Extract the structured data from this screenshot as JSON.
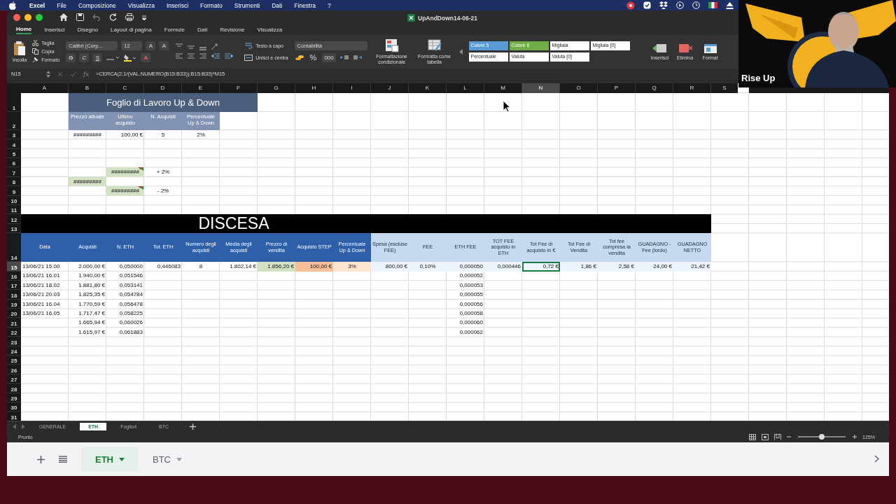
{
  "menubar": {
    "app_name": "Excel",
    "items": [
      "File",
      "Composizione",
      "Visualizza",
      "Inserisci",
      "Formato",
      "Strumenti",
      "Dati",
      "Finestra",
      "?"
    ]
  },
  "window": {
    "title": "UpAndDown14-06-21"
  },
  "ribbon_tabs": [
    {
      "label": "Home",
      "selected": true
    },
    {
      "label": "Inserisci",
      "selected": false
    },
    {
      "label": "Disegno",
      "selected": false
    },
    {
      "label": "Layout di pagina",
      "selected": false
    },
    {
      "label": "Formule",
      "selected": false
    },
    {
      "label": "Dati",
      "selected": false
    },
    {
      "label": "Revisione",
      "selected": false
    },
    {
      "label": "Visualizza",
      "selected": false
    }
  ],
  "ribbon": {
    "paste": "Incolla",
    "cut": "Taglia",
    "copy": "Copia",
    "format_painter": "Formato",
    "font_name": "Calibri (Corp...",
    "font_size": "12",
    "grow": "A",
    "shrink": "A",
    "bold": "G",
    "italic": "C",
    "underline": "S",
    "font_color": "A",
    "wrap": "Testo a capo",
    "merge": "Unisci e centra",
    "number_format": "Contabilità",
    "percent": "%",
    "thousands": "000",
    "conditional": "Formattazione condizionale",
    "as_table": "Formatta come tabella",
    "styles": [
      {
        "label": "Colore 5",
        "kind": "accent",
        "color": "#5b9bd5"
      },
      {
        "label": "Colore 6",
        "kind": "accent",
        "color": "#70ad47"
      },
      {
        "label": "Migliaia",
        "kind": "plain"
      },
      {
        "label": "Migliaia [0]",
        "kind": "plain"
      },
      {
        "label": "Percentuale",
        "kind": "plain"
      },
      {
        "label": "Valuta",
        "kind": "plain"
      },
      {
        "label": "Valuta [0]",
        "kind": "plain"
      }
    ],
    "cells": [
      "Inserisci",
      "Elimina",
      "Format"
    ]
  },
  "formula_bar": {
    "name_box": "N15",
    "fx": "fx",
    "formula": "=CERCA(2;1/(VAL.NUMERO(B15:B33));B15:B33)*M15"
  },
  "sheet": {
    "columns": [
      {
        "letter": "A",
        "selected": false
      },
      {
        "letter": "B",
        "selected": false
      },
      {
        "letter": "C",
        "selected": false
      },
      {
        "letter": "D",
        "selected": false
      },
      {
        "letter": "E",
        "selected": false
      },
      {
        "letter": "F",
        "selected": false
      },
      {
        "letter": "G",
        "selected": false
      },
      {
        "letter": "H",
        "selected": false
      },
      {
        "letter": "I",
        "selected": false
      },
      {
        "letter": "J",
        "selected": false
      },
      {
        "letter": "K",
        "selected": false
      },
      {
        "letter": "L",
        "selected": false
      },
      {
        "letter": "M",
        "selected": false
      },
      {
        "letter": "N",
        "selected": true
      },
      {
        "letter": "O",
        "selected": false
      },
      {
        "letter": "P",
        "selected": false
      },
      {
        "letter": "Q",
        "selected": false
      },
      {
        "letter": "R",
        "selected": false
      },
      {
        "letter": "S",
        "selected": false
      }
    ],
    "rows": [
      {
        "label": "1",
        "selected": false
      },
      {
        "label": "2",
        "selected": false
      },
      {
        "label": "3",
        "selected": false
      },
      {
        "label": "4",
        "selected": false
      },
      {
        "label": "5",
        "selected": false
      },
      {
        "label": "6",
        "selected": false
      },
      {
        "label": "7",
        "selected": false
      },
      {
        "label": "8",
        "selected": false
      },
      {
        "label": "9",
        "selected": false
      },
      {
        "label": "10",
        "selected": false
      },
      {
        "label": "11",
        "selected": false
      },
      {
        "label": "12",
        "selected": false
      },
      {
        "label": "13",
        "selected": false
      },
      {
        "label": "14",
        "selected": false
      },
      {
        "label": "15",
        "selected": true
      },
      {
        "label": "16",
        "selected": false
      },
      {
        "label": "17",
        "selected": false
      },
      {
        "label": "18",
        "selected": false
      },
      {
        "label": "19",
        "selected": false
      },
      {
        "label": "20",
        "selected": false
      },
      {
        "label": "21",
        "selected": false
      },
      {
        "label": "22",
        "selected": false
      },
      {
        "label": "23",
        "selected": false
      },
      {
        "label": "24",
        "selected": false
      },
      {
        "label": "25",
        "selected": false
      },
      {
        "label": "26",
        "selected": false
      },
      {
        "label": "27",
        "selected": false
      },
      {
        "label": "28",
        "selected": false
      },
      {
        "label": "29",
        "selected": false
      },
      {
        "label": "30",
        "selected": false
      },
      {
        "label": "31",
        "selected": false
      }
    ],
    "summary": {
      "title": "Foglio di Lavoro Up & Down",
      "headers": [
        "Prezzo attuale",
        "Ultimo acquisto",
        "N. Acquisti",
        "Percentuale Up & Down"
      ],
      "values": [
        "#########",
        "100,00 €",
        "5",
        "2%"
      ]
    },
    "levels": {
      "upper": {
        "value": "#########",
        "label": "+ 2%",
        "comment": true
      },
      "current": "#########",
      "lower": {
        "value": "#########",
        "label": "- 2%",
        "comment": true
      }
    },
    "section": "DISCESA",
    "table": {
      "columns": [
        {
          "label": "Data",
          "kind": "dark"
        },
        {
          "label": "Acquisti",
          "kind": "dark"
        },
        {
          "label": "N. ETH",
          "kind": "dark"
        },
        {
          "label": "Tot. ETH",
          "kind": "dark"
        },
        {
          "label": "Numero degli acquisti",
          "kind": "dark"
        },
        {
          "label": "Media degli acquisti",
          "kind": "dark"
        },
        {
          "label": "Prezzo di vendita",
          "kind": "dark"
        },
        {
          "label": "Acquisto STEP",
          "kind": "dark"
        },
        {
          "label": "Percentuale Up & Down",
          "kind": "dark"
        },
        {
          "label": "Spesa (escluse FEE)",
          "kind": "light"
        },
        {
          "label": "FEE",
          "kind": "light"
        },
        {
          "label": "ETH FEE",
          "kind": "light"
        },
        {
          "label": "TOT FEE acquisto in ETH",
          "kind": "light"
        },
        {
          "label": "Tot Fee di acquisto in €",
          "kind": "light"
        },
        {
          "label": "Tot Fee di Vendita",
          "kind": "light"
        },
        {
          "label": "Tot fee compresa la vendita",
          "kind": "light"
        },
        {
          "label": "GUADAGNO - Fee (lordo)",
          "kind": "light"
        },
        {
          "label": "GUADAGNO NETTO",
          "kind": "light"
        }
      ],
      "rows": [
        {
          "data": "13/06/21 15.00",
          "acquisti": "2.000,00 €",
          "n_eth": "0,050000",
          "tot_eth": "0,446083",
          "numero": "8",
          "media": "1.802,14 €",
          "prezzo_vendita": "1.856,20 €",
          "step": "100,00 €",
          "percentuale": "3%",
          "spesa": "800,00 €",
          "fee": "0,10%",
          "eth_fee": "0,000050",
          "fee_eth": "0,000446",
          "fee_eur": "0,72 €",
          "fee_vendita": "1,86 €",
          "fee_totale": "2,58 €",
          "lordo": "24,00 €",
          "netto": "21,42 €"
        },
        {
          "data": "13/06/21 16.01",
          "acquisti": "1.940,00 €",
          "n_eth": "0,051546",
          "eth_fee": "0,000052"
        },
        {
          "data": "13/06/21 18.02",
          "acquisti": "1.881,80 €",
          "n_eth": "0,053141",
          "eth_fee": "0,000053"
        },
        {
          "data": "13/06/21 20.03",
          "acquisti": "1.825,35 €",
          "n_eth": "0,054784",
          "eth_fee": "0,000055"
        },
        {
          "data": "13/06/21 16.04",
          "acquisti": "1.770,59 €",
          "n_eth": "0,056478",
          "eth_fee": "0,000056"
        },
        {
          "data": "13/06/21 16.05",
          "acquisti": "1.717,47 €",
          "n_eth": "0,058225",
          "eth_fee": "0,000058"
        },
        {
          "acquisti": "1.665,94 €",
          "n_eth": "0,060026",
          "eth_fee": "0,000060"
        },
        {
          "acquisti": "1.615,97 €",
          "n_eth": "0,061883",
          "eth_fee": "0,000062"
        }
      ]
    }
  },
  "sheet_tabs": [
    {
      "label": "GENERALE",
      "selected": false
    },
    {
      "label": "ETH",
      "selected": true
    },
    {
      "label": "Foglio4",
      "selected": false
    },
    {
      "label": "BTC",
      "selected": false
    }
  ],
  "status_bar": {
    "status": "Pronto",
    "zoom": "125%",
    "zoom_slider": {
      "level": 0.5
    }
  },
  "web_tabs": [
    {
      "label": "ETH",
      "selected": true
    },
    {
      "label": "BTC",
      "selected": false
    }
  ],
  "webcam": {
    "name": "Rise Up"
  }
}
